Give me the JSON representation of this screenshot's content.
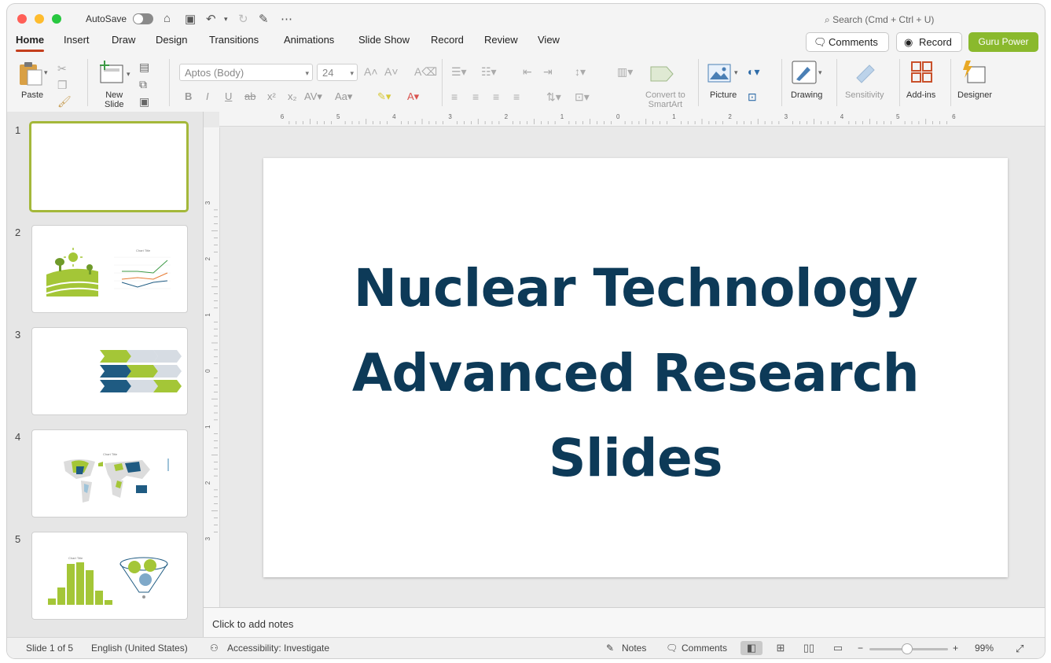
{
  "titlebar": {
    "autosave_label": "AutoSave",
    "search_placeholder": "Search (Cmd + Ctrl + U)"
  },
  "menu": {
    "tabs": [
      "Home",
      "Insert",
      "Draw",
      "Design",
      "Transitions",
      "Animations",
      "Slide Show",
      "Record",
      "Review",
      "View"
    ],
    "active_tab": "Home",
    "comments_label": "Comments",
    "record_label": "Record",
    "guru_label": "Guru Power"
  },
  "ribbon": {
    "paste_label": "Paste",
    "new_slide_label": "New\nSlide",
    "font_name": "Aptos (Body)",
    "font_size": "24",
    "convert_label": "Convert to\nSmartArt",
    "picture_label": "Picture",
    "drawing_label": "Drawing",
    "sensitivity_label": "Sensitivity",
    "addins_label": "Add-ins",
    "designer_label": "Designer"
  },
  "ruler": {
    "h_labels": [
      "6",
      "5",
      "4",
      "3",
      "2",
      "1",
      "0",
      "1",
      "2",
      "3",
      "4",
      "5",
      "6"
    ],
    "v_labels": [
      "3",
      "2",
      "1",
      "0",
      "1",
      "2",
      "3"
    ]
  },
  "slides_panel": {
    "numbers": [
      "1",
      "2",
      "3",
      "4",
      "5"
    ],
    "thumb_chart_title": "Chart Title"
  },
  "slide": {
    "title_line1": "Nuclear Technology",
    "title_line2": "Advanced Research",
    "title_line3": "Slides",
    "title_color": "#0d3a58"
  },
  "notes": {
    "placeholder": "Click to add notes"
  },
  "status": {
    "slide_info": "Slide 1 of 5",
    "language": "English (United States)",
    "accessibility": "Accessibility: Investigate",
    "notes_label": "Notes",
    "comments_label": "Comments",
    "zoom": "99%"
  },
  "colors": {
    "accent_green": "#8ab92d",
    "dark_blue": "#1f5b82",
    "active_tab_underline": "#c43e1c"
  }
}
